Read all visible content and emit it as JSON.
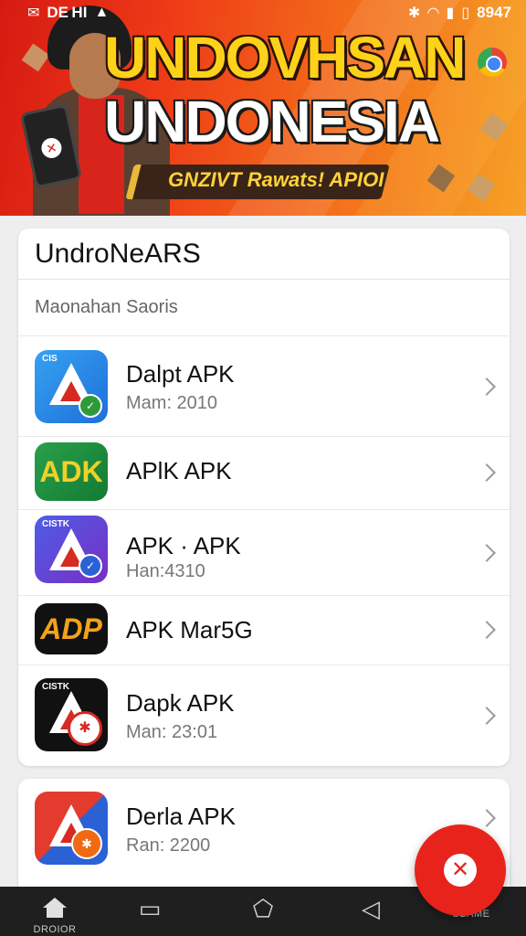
{
  "status_bar": {
    "left_text": "DE HI",
    "right_text": "8947",
    "icons": [
      "notification-icon",
      "bluetooth-icon",
      "wifi-icon",
      "signal-icon",
      "battery-icon"
    ]
  },
  "banner": {
    "title_line1": "UNDOVHSAN",
    "title_line2": "UNDONESIA",
    "ribbon_text": "GNZIVT Rawats! APIOI"
  },
  "card": {
    "header": "UndroNeARS",
    "section_label": "Maonahan Saoris",
    "items": [
      {
        "title": "Dalpt APK",
        "subtitle": "Mam: 2010",
        "icon": "blue-triangle-app-icon"
      },
      {
        "title": "APlK  APK",
        "subtitle": "",
        "icon": "green-adk-app-icon",
        "icon_text": "ADK"
      },
      {
        "title": "APK  ·  APK",
        "subtitle": "Han:4310",
        "icon": "purple-triangle-app-icon"
      },
      {
        "title": "APK Mar5G",
        "subtitle": "",
        "icon": "black-adp-app-icon",
        "icon_text": "ADP"
      },
      {
        "title": "Dapk APK",
        "subtitle": "Man: 23:01",
        "icon": "black-triangle-app-icon"
      }
    ]
  },
  "card2": {
    "items": [
      {
        "title": "Derla APK",
        "subtitle": "Ran: 2200",
        "icon": "split-triangle-app-icon"
      }
    ]
  },
  "fab": {
    "icon": "close-icon",
    "glyph": "✕"
  },
  "nav": {
    "items": [
      {
        "label": "DROIOR",
        "icon": "home-icon"
      },
      {
        "label": "",
        "icon": "recents-icon"
      },
      {
        "label": "",
        "icon": "home-circle-icon"
      },
      {
        "label": "",
        "icon": "back-icon"
      },
      {
        "label": "SBAME",
        "icon": "menu-icon"
      }
    ]
  },
  "colors": {
    "accent_red": "#e8231b",
    "banner_orange": "#f36a1a",
    "title_yellow": "#ffd21a"
  }
}
